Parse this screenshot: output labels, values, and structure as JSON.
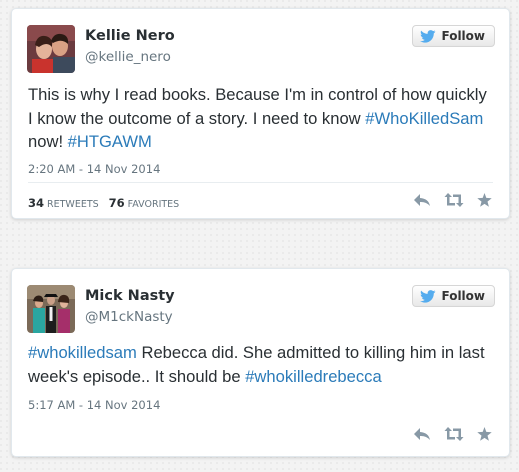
{
  "tweets": [
    {
      "name": "Kellie Nero",
      "handle": "@kellie_nero",
      "follow_label": "Follow",
      "text_parts": [
        {
          "text": "This is why I read books. Because I'm in control of how quickly I know the outcome of a story. I need to know "
        },
        {
          "text": "#WhoKilledSam",
          "hashtag": true
        },
        {
          "text": " now! "
        },
        {
          "text": "#HTGAWM",
          "hashtag": true
        }
      ],
      "timestamp": "2:20 AM - 14 Nov 2014",
      "retweets_count": "34",
      "retweets_label": "RETWEETS",
      "favorites_count": "76",
      "favorites_label": "FAVORITES",
      "actions": [
        "reply-icon",
        "retweet-icon",
        "favorite-icon"
      ]
    },
    {
      "name": "Mick Nasty",
      "handle": "@M1ckNasty",
      "follow_label": "Follow",
      "text_parts": [
        {
          "text": "#whokilledsam",
          "hashtag": true
        },
        {
          "text": " Rebecca did. She admitted to killing him in last week's episode.. It should be "
        },
        {
          "text": "#whokilledrebecca",
          "hashtag": true
        }
      ],
      "timestamp": "5:17 AM - 14 Nov 2014",
      "actions": [
        "reply-icon",
        "retweet-icon",
        "favorite-icon"
      ]
    }
  ],
  "colors": {
    "link": "#2b7bb9",
    "text": "#292f33",
    "muted": "#66757f",
    "twitter_bird": "#55acee",
    "action_icon": "#8899a6"
  }
}
